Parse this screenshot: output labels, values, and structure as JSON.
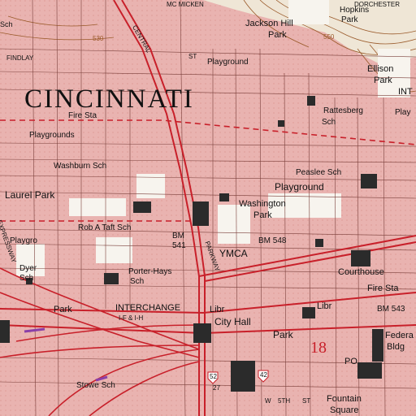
{
  "map": {
    "city": "CINCINNATI",
    "colors": {
      "urban_tint": "#e9b3b0",
      "street": "#ffffff",
      "street_casing": "#7a3f3a",
      "major_road": "#c8202a",
      "boundary": "#c8202a",
      "contour": "#9a5a2a",
      "park_white": "#f7f4ee",
      "building": "#2b2b2b",
      "highway_purple": "#8a3fa8"
    },
    "labels": {
      "mcmicken": "MC MICKEN",
      "dorchester": "DORCHESTER",
      "hopkins_park": "Hopkins",
      "hopkins_park2": "Park",
      "jackson_hill": "Jackson Hill",
      "jackson_hill2": "Park",
      "central": "CENTRAL",
      "findlay": "FINDLAY",
      "st_upper": "ST",
      "playground_top": "Playground",
      "ellison_park": "Ellison",
      "ellison_park2": "Park",
      "int_right": "INT",
      "rattesberg": "Rattesberg",
      "rattesberg_sch": "Sch",
      "playground_right": "Play",
      "fire_sta_left": "Fire Sta",
      "playgrounds": "Playgrounds",
      "washburn": "Washburn Sch",
      "laurel_park": "Laurel Park",
      "peaslee": "Peaslee Sch",
      "playground_mid": "Playground",
      "washington": "Washington",
      "washington_park": "Park",
      "rob_taft": "Rob A Taft Sch",
      "expressway": "EXPRESSWAY",
      "playgro": "Playgro",
      "bm541": "BM",
      "bm541_num": "541",
      "bm548": "BM 548",
      "parkway": "PARKWAY",
      "ymca": "YMCA",
      "porter": "Porter-Hays",
      "porter_sch": "Sch",
      "dyer": "Dyer",
      "dyer_sch": "Sch",
      "courthouse": "Courthouse",
      "fire_sta_right": "Fire Sta",
      "park_left": "Park",
      "interchange": "INTERCHANGE",
      "interchange_sub": "I-F & I-H",
      "libr_mid": "Libr",
      "libr_right": "Libr",
      "bm543": "BM 543",
      "city_hall": "City Hall",
      "park_mid": "Park",
      "route18": "18",
      "po": "PO",
      "federal": "Federa",
      "bldg": "Bldg",
      "stowe": "Stowe Sch",
      "fifth_st": "W",
      "fifth_st2": "5TH",
      "fifth_st3": "ST",
      "fountain": "Fountain",
      "square": "Square",
      "sch_top_left": "Sch",
      "num530": "530",
      "num550": "550",
      "shield52": "52",
      "shield42": "42",
      "shield127": "27"
    }
  }
}
